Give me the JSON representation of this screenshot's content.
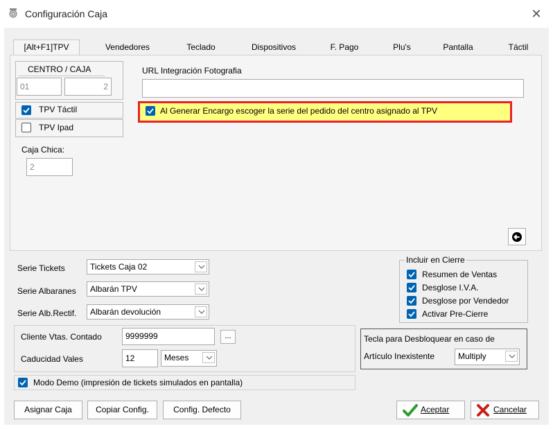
{
  "window": {
    "title": "Configuración Caja",
    "close_glyph": "✕",
    "icon": "configuration-icon"
  },
  "tabs": [
    {
      "label": "[Alt+F1]TPV",
      "active": true
    },
    {
      "label": "Vendedores",
      "active": false
    },
    {
      "label": "Teclado",
      "active": false
    },
    {
      "label": "Dispositivos",
      "active": false
    },
    {
      "label": "F. Pago",
      "active": false
    },
    {
      "label": "Plu's",
      "active": false
    },
    {
      "label": "Pantalla",
      "active": false
    },
    {
      "label": "Táctil",
      "active": false
    }
  ],
  "centro_caja": {
    "header": "CENTRO / CAJA",
    "centro": "01",
    "caja": "2"
  },
  "tpv_type": {
    "tactil": {
      "label": "TPV Táctil",
      "checked": true
    },
    "ipad": {
      "label": "TPV Ipad",
      "checked": false
    }
  },
  "caja_chica": {
    "label": "Caja Chica:",
    "value": "2"
  },
  "url_foto": {
    "label": "URL Integración Fotografia",
    "value": ""
  },
  "encargo": {
    "label": "Al Generar Encargo escoger la serie del pedido del centro asignado al TPV",
    "checked": true,
    "highlight_color": "#e8202a",
    "bg_color": "#ffff80"
  },
  "arrow_button_icon": "arrow-left-icon",
  "series": {
    "tickets": {
      "label": "Serie Tickets",
      "value": "Tickets Caja 02"
    },
    "albaranes": {
      "label": "Serie Albaranes",
      "value": "Albarán TPV"
    },
    "alb_rectif": {
      "label": "Serie Alb.Rectif.",
      "value": "Albarán devolución"
    }
  },
  "incluir_cierre": {
    "title": "Incluir en Cierre",
    "items": [
      {
        "label": "Resumen de Ventas",
        "checked": true
      },
      {
        "label": "Desglose I.V.A.",
        "checked": true
      },
      {
        "label": "Desglose por Vendedor",
        "checked": true
      },
      {
        "label": "Activar Pre-Cierre",
        "checked": true
      }
    ]
  },
  "cliente": {
    "label": "Cliente Vtas. Contado",
    "value": "9999999",
    "browse": "..."
  },
  "caducidad": {
    "label": "Caducidad Vales",
    "value": "12",
    "unit": "Meses"
  },
  "tecla": {
    "line1": "Tecla para Desbloquear en caso de",
    "line2": "Artículo Inexistente",
    "value": "Multiply"
  },
  "modo_demo": {
    "label": "Modo Demo (impresión de tickets simulados en pantalla)",
    "checked": true
  },
  "buttons": {
    "asignar": "Asignar Caja",
    "copiar": "Copiar Config.",
    "defecto": "Config. Defecto",
    "aceptar": "Aceptar",
    "cancelar": "Cancelar"
  },
  "colors": {
    "accent": "#0063b1",
    "ok_green": "#2e9d2e",
    "cancel_red": "#c81e1e"
  }
}
